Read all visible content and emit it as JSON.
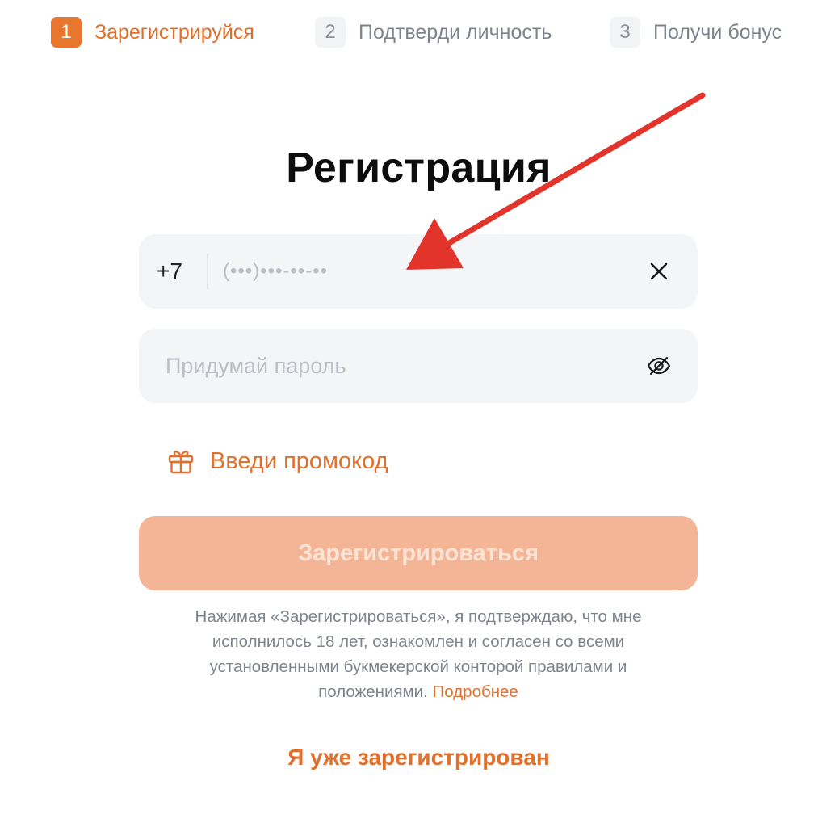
{
  "stepper": {
    "steps": [
      {
        "number": "1",
        "label": "Зарегистрируйся",
        "state": "active"
      },
      {
        "number": "2",
        "label": "Подтверди личность",
        "state": "inactive"
      },
      {
        "number": "3",
        "label": "Получи бонус",
        "state": "inactive"
      }
    ]
  },
  "form": {
    "title": "Регистрация",
    "phone": {
      "prefix": "+7",
      "placeholder": "(•••)•••-••-••",
      "value": "",
      "clear_icon": "close-icon"
    },
    "password": {
      "placeholder": "Придумай пароль",
      "value": "",
      "toggle_icon": "eye-off-icon"
    },
    "promo": {
      "label": "Введи промокод",
      "icon": "gift-icon"
    },
    "submit_label": "Зарегистрироваться",
    "disclaimer": {
      "text": "Нажимая «Зарегистрироваться», я подтверждаю, что мне исполнилось 18 лет, ознакомлен и согласен со всеми установленными букмекерской конторой правилами и положениями.",
      "link": "Подробнее"
    },
    "login_link": "Я уже зарегистрирован"
  },
  "colors": {
    "accent": "#e9762f",
    "accent_text": "#e0702c",
    "button_disabled": "#f4b597",
    "field_bg": "#f3f5f7",
    "annotation_arrow": "#e2342b"
  },
  "annotation": {
    "type": "arrow",
    "points_to": "phone-input"
  }
}
